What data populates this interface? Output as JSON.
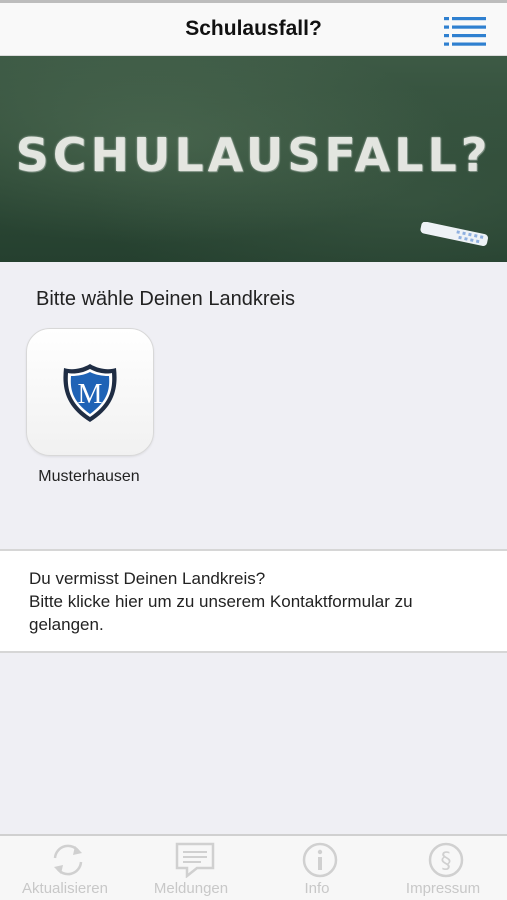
{
  "header": {
    "title": "Schulausfall?",
    "menu_icon": "list-menu-icon"
  },
  "banner": {
    "text": "SCHULAUSFALL?",
    "chalk_icon": "chalk-icon"
  },
  "main": {
    "section_title": "Bitte wähle Deinen Landkreis",
    "districts": [
      {
        "label": "Musterhausen",
        "icon": "shield-m-icon",
        "badge_letter": "M"
      }
    ]
  },
  "contact": {
    "line1": "Du vermisst Deinen Landkreis?",
    "line2": "Bitte klicke hier um zu unserem Kontaktformular zu gelangen."
  },
  "tabbar": {
    "items": [
      {
        "label": "Aktualisieren",
        "icon": "refresh-icon"
      },
      {
        "label": "Meldungen",
        "icon": "message-icon"
      },
      {
        "label": "Info",
        "icon": "info-icon"
      },
      {
        "label": "Impressum",
        "icon": "paragraph-icon"
      }
    ]
  },
  "colors": {
    "accent": "#2f80d0",
    "chalkboard": "#2e4a37",
    "tab_inactive": "#c8c8c8"
  }
}
